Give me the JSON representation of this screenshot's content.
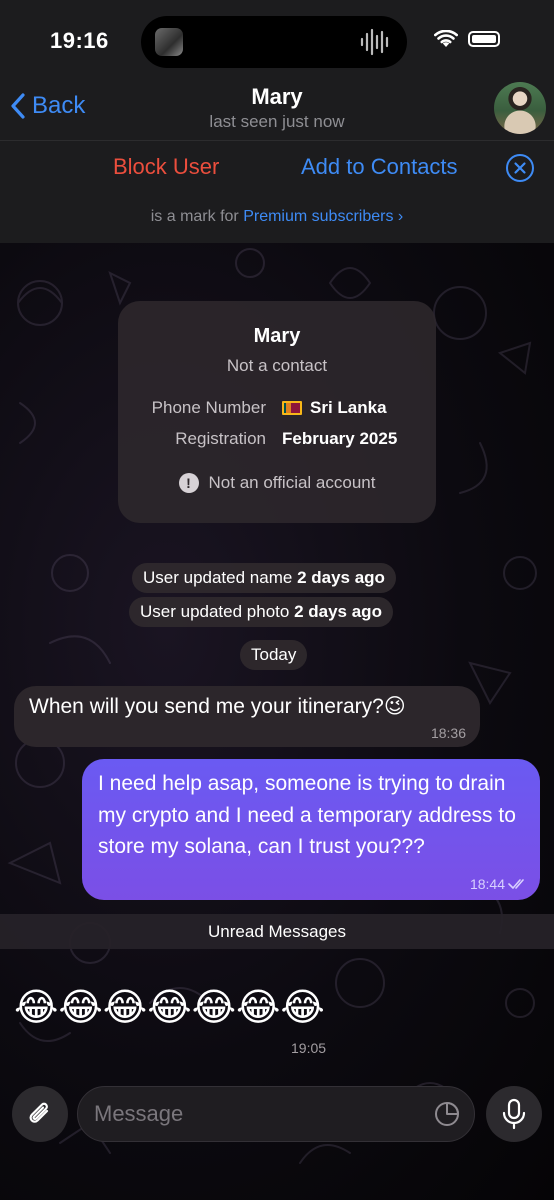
{
  "status_bar": {
    "time": "19:16"
  },
  "nav": {
    "back_label": "Back",
    "title": "Mary",
    "subtitle": "last seen just now"
  },
  "actions": {
    "block_label": "Block User",
    "add_contacts_label": "Add to Contacts",
    "premium_text": "is a mark for",
    "premium_link": "Premium subscribers"
  },
  "info_card": {
    "name": "Mary",
    "subtitle": "Not a contact",
    "phone_label": "Phone Number",
    "phone_value": "Sri Lanka",
    "registration_label": "Registration",
    "registration_value": "February 2025",
    "official_text": "Not an official account"
  },
  "service_messages": [
    {
      "text": "User updated name",
      "bold": "2 days ago"
    },
    {
      "text": "User updated photo",
      "bold": "2 days ago"
    }
  ],
  "date_pill": "Today",
  "messages": [
    {
      "direction": "incoming",
      "text": "When will you send me your itinerary?😉",
      "time": "18:36"
    },
    {
      "direction": "outgoing",
      "text": "I need help asap, someone is trying to drain my crypto and I need a temporary address to store my solana, can I trust you???",
      "time": "18:44"
    }
  ],
  "unread_label": "Unread Messages",
  "emoji_message": {
    "text": "😂😂😂😂😂😂😂",
    "time": "19:05"
  },
  "input": {
    "placeholder": "Message"
  },
  "colors": {
    "accent": "#3e8bf5",
    "danger": "#eb4e3d",
    "outgoing_bubble": "#6a5af2"
  }
}
